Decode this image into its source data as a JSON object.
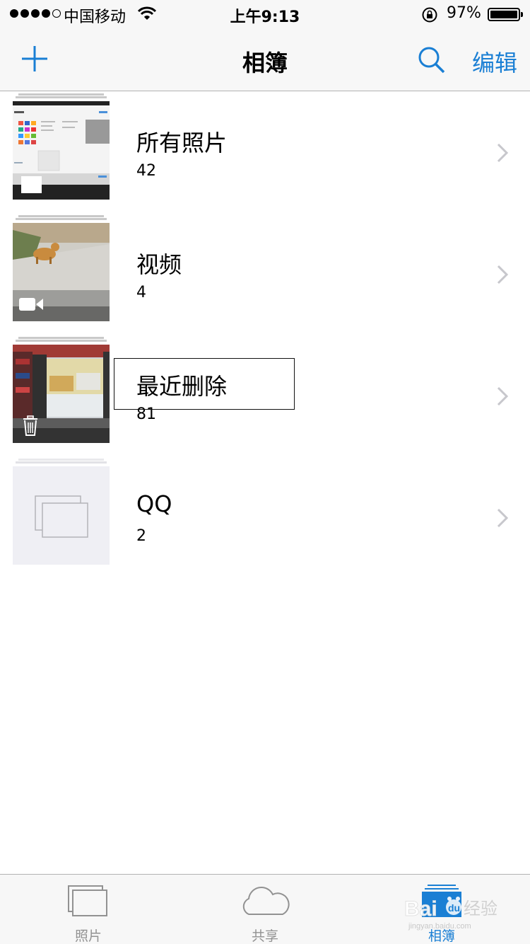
{
  "status_bar": {
    "carrier": "中国移动",
    "time": "上午9:13",
    "battery_percent": "97%",
    "battery_level": 0.97,
    "signal_bars": 4
  },
  "nav": {
    "title": "相簿",
    "edit_label": "编辑",
    "add_icon": "plus-icon",
    "search_icon": "search-icon"
  },
  "albums": [
    {
      "name": "所有照片",
      "count": "42",
      "overlay_icon": ""
    },
    {
      "name": "视频",
      "count": "4",
      "overlay_icon": "video-camera-icon"
    },
    {
      "name": "最近删除",
      "count": "81",
      "overlay_icon": "trash-icon"
    },
    {
      "name": "QQ",
      "count": "2",
      "overlay_icon": ""
    }
  ],
  "tabs": [
    {
      "label": "照片",
      "icon": "photos-icon",
      "active": false
    },
    {
      "label": "共享",
      "icon": "cloud-icon",
      "active": false
    },
    {
      "label": "相簿",
      "icon": "albums-icon",
      "active": true
    }
  ],
  "colors": {
    "accent": "#1a7fd4",
    "bar_background": "#f7f7f7",
    "inactive_tab": "#929292"
  },
  "watermark": "Baidu经验"
}
